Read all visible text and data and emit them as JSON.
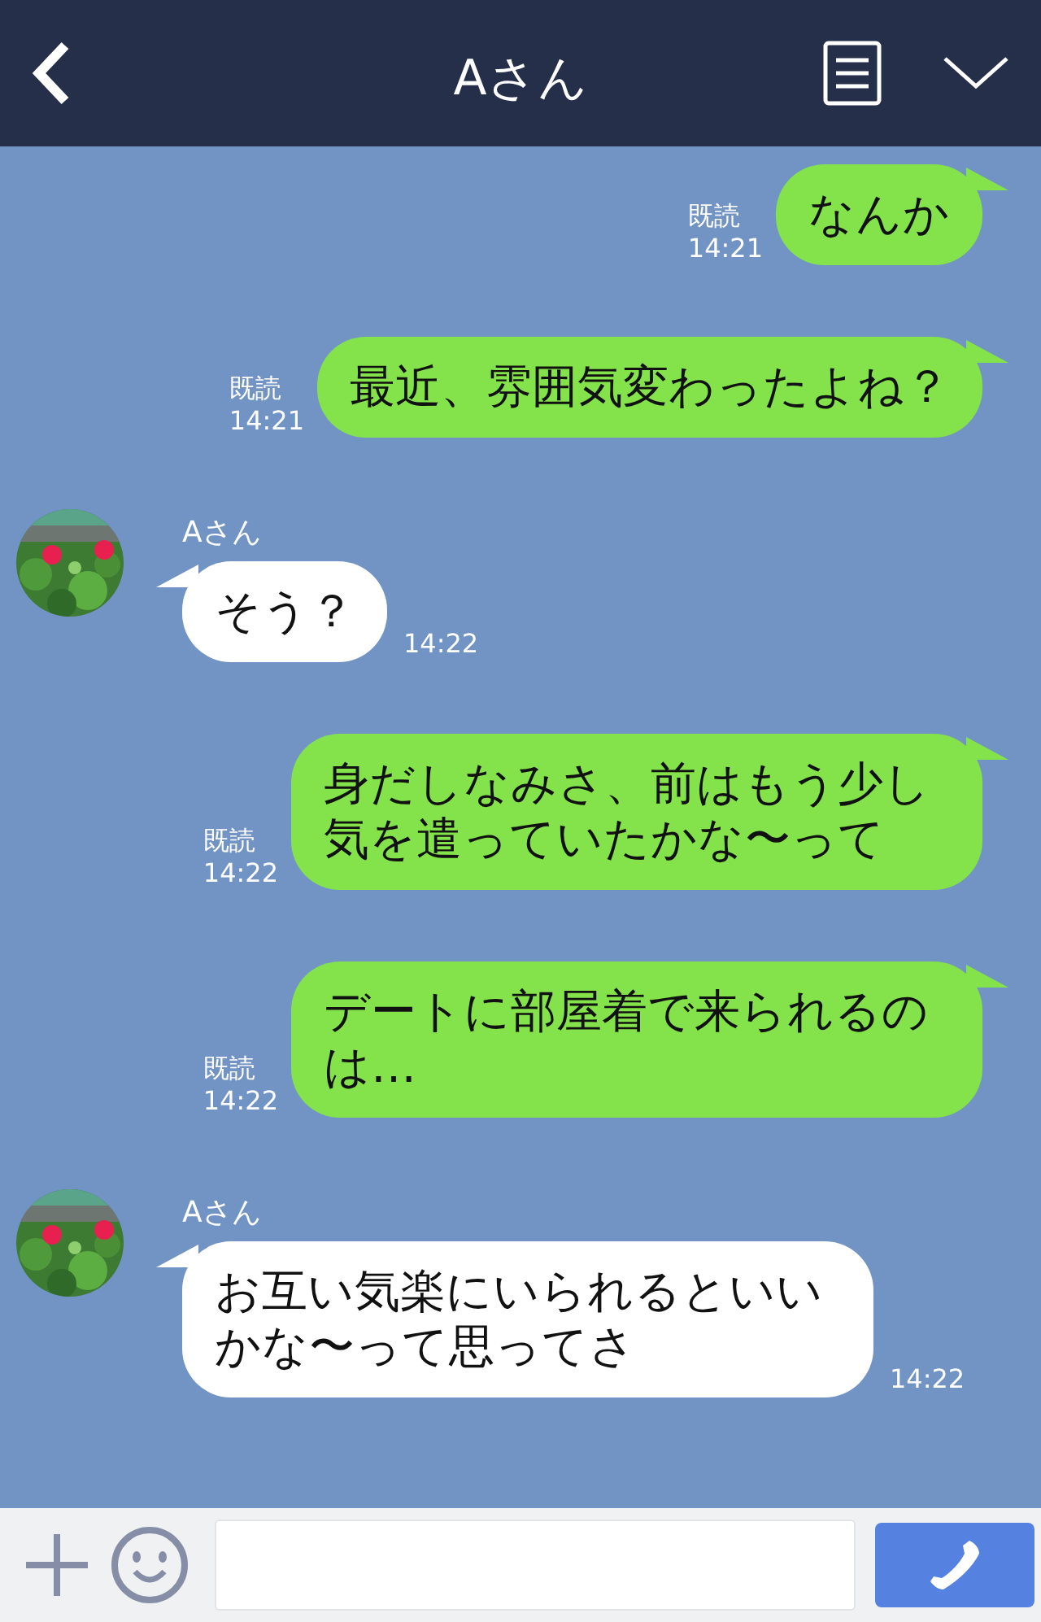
{
  "header": {
    "title": "Aさん"
  },
  "messages": [
    {
      "kind": "sent",
      "text": "なんか",
      "read": "既読",
      "time": "14:21"
    },
    {
      "kind": "sent",
      "text": "最近、雰囲気変わったよね？",
      "read": "既読",
      "time": "14:21"
    },
    {
      "kind": "received",
      "sender": "Aさん",
      "text": "そう？",
      "time": "14:22"
    },
    {
      "kind": "sent",
      "text": "身だしなみさ、前はもう少し気を遣っていたかな〜って",
      "read": "既読",
      "time": "14:22"
    },
    {
      "kind": "sent",
      "text": "デートに部屋着で来られるのは…",
      "read": "既読",
      "time": "14:22"
    },
    {
      "kind": "received",
      "sender": "Aさん",
      "text": "お互い気楽にいられるといいかな〜って思ってさ",
      "time": "14:22"
    }
  ]
}
